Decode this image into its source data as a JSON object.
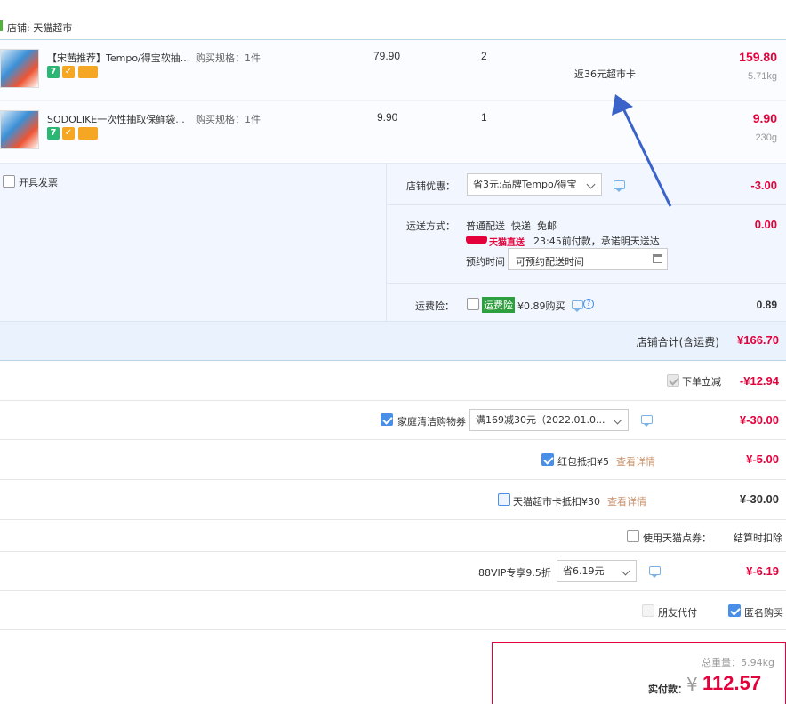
{
  "store": {
    "label": "店铺: 天猫超市"
  },
  "items": [
    {
      "title": "【宋茜推荐】Tempo/得宝软抽...",
      "spec": "购买规格：1件",
      "price": "79.90",
      "qty": "2",
      "promo": "返36元超市卡",
      "total": "159.80",
      "weight": "5.71kg",
      "badge1": "7"
    },
    {
      "title": "SODOLIKE一次性抽取保鲜袋...",
      "spec": "购买规格：1件",
      "price": "9.90",
      "qty": "1",
      "total": "9.90",
      "weight": "230g",
      "badge1": "7"
    }
  ],
  "invoice": {
    "label": "开具发票"
  },
  "store_discount": {
    "label": "店铺优惠：",
    "selected": "省3元:品牌Tempo/得宝",
    "amount": "-3.00"
  },
  "shipping": {
    "label": "运送方式：",
    "method": "普通配送  快递  免邮",
    "express_brand": "天猫直送",
    "promise": "23:45前付款，承诺明天送达",
    "appt_label": "预约时间",
    "appt_placeholder": "可预约配送时间",
    "amount": "0.00"
  },
  "insurance": {
    "label": "运费险：",
    "tag": "运费险",
    "price": "¥0.89购买",
    "amount": "0.89"
  },
  "store_total": {
    "label": "店铺合计(含运费)",
    "amount": "¥166.70"
  },
  "order_discount": {
    "label": "下单立减",
    "amount": "-¥12.94"
  },
  "coupon": {
    "label": "家庭清洁购物券",
    "selected": "满169减30元（2022.01.0...",
    "amount": "¥-30.00"
  },
  "red_packet": {
    "label": "红包抵扣¥5",
    "detail": "查看详情",
    "amount": "¥-5.00"
  },
  "tmall_card": {
    "label": "天猫超市卡抵扣¥30",
    "detail": "查看详情",
    "amount": "¥-30.00"
  },
  "points": {
    "label": "使用天猫点券：",
    "note": "结算时扣除"
  },
  "vip": {
    "label": "88VIP专享9.5折",
    "selected": "省6.19元",
    "amount": "¥-6.19"
  },
  "options": {
    "friend_pay": "朋友代付",
    "anonymous": "匿名购买"
  },
  "summary": {
    "weight": "总重量：5.94kg",
    "pay_label": "实付款：",
    "currency": "¥",
    "pay_amount": "112.57"
  },
  "colors": {
    "accent": "#e4003a",
    "link": "#ff6600",
    "check": "#4a8fe7",
    "arrow": "#3a63c9"
  }
}
